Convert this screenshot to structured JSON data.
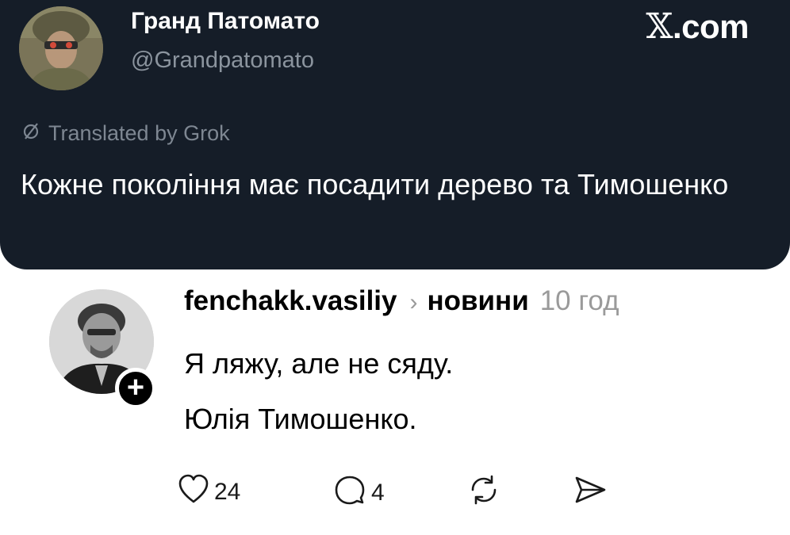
{
  "tweet": {
    "author_name": "Гранд Патомато",
    "author_handle": "@Grandpatomato",
    "brand": ".com",
    "translated_label": "Translated by Grok",
    "text": "Кожне покоління має посадити дерево та Тимошенко"
  },
  "reply": {
    "username": "fenchakk.vasiliy",
    "feed": "новини",
    "time": "10 год",
    "line1": "Я ляжу, але не сяду.",
    "line2": "Юлія Тимошенко.",
    "likes": "24",
    "comments": "4",
    "follow_symbol": "+"
  },
  "icons": {
    "translate": "translate-icon",
    "like": "heart-icon",
    "comment": "comment-icon",
    "repost": "repost-icon",
    "share": "share-icon",
    "brand": "x-logo-icon"
  },
  "colors": {
    "card_bg": "#151d28",
    "muted": "#8b949e",
    "text_light": "#ffffff",
    "text_dark": "#000000"
  }
}
